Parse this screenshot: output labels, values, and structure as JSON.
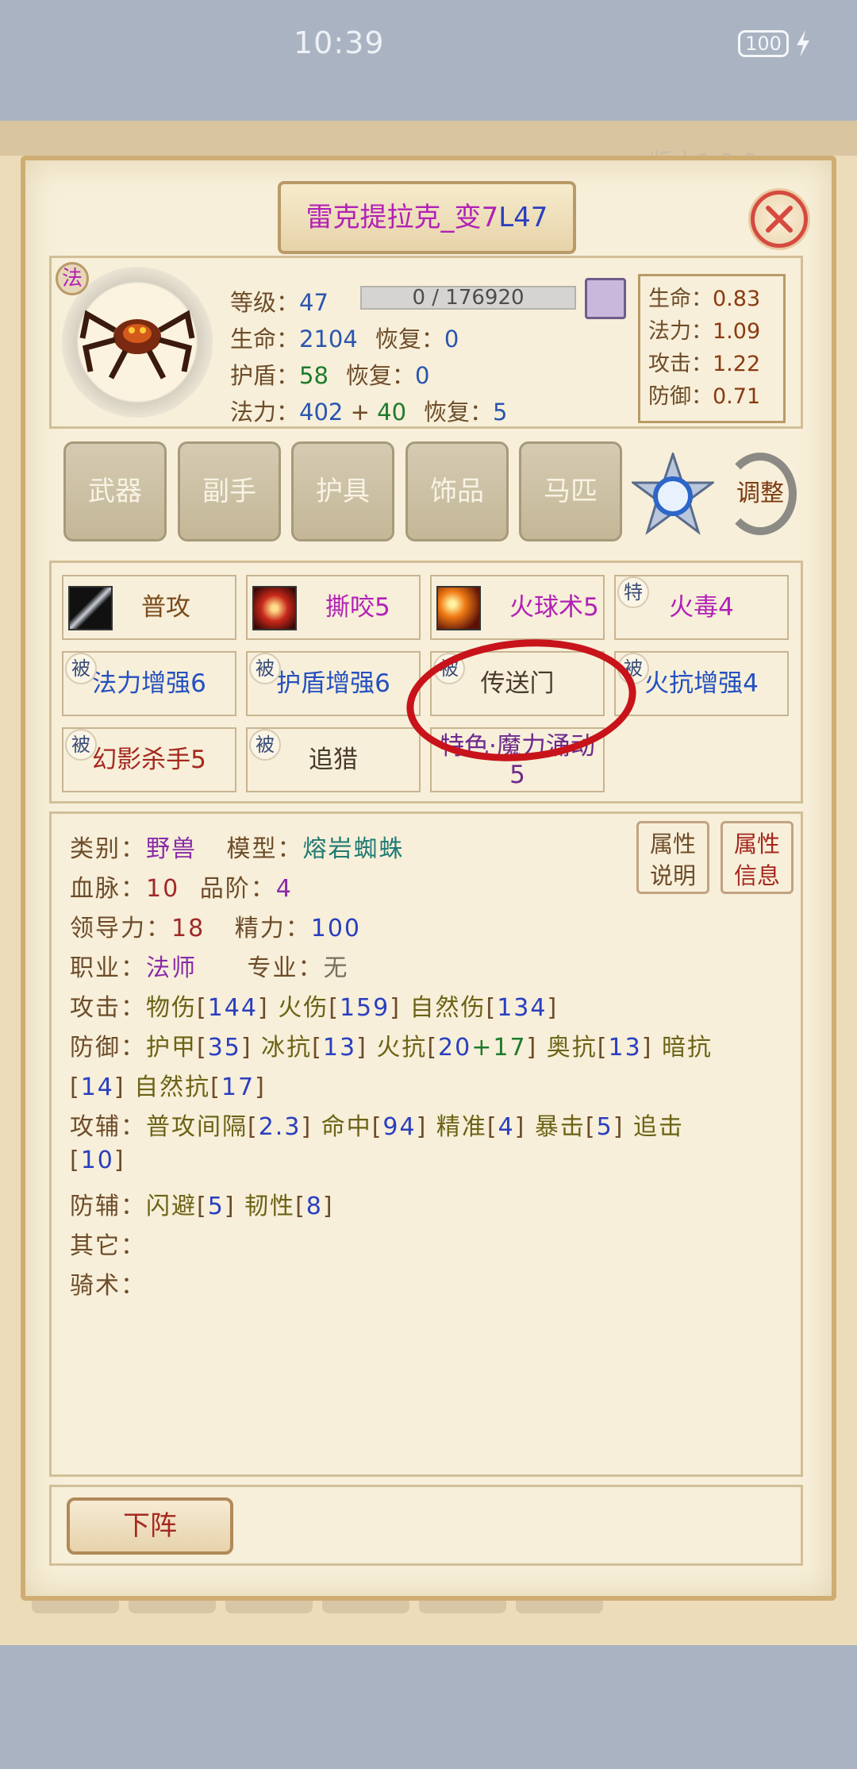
{
  "status_bar": {
    "time": "10:39",
    "battery": "100"
  },
  "version": "版本1.0.0",
  "title": {
    "name": "雷克提拉克_变",
    "num": "7",
    "level": "L47"
  },
  "pet": {
    "class_badge": "法",
    "level_label": "等级：",
    "level": "47",
    "xp": "0 / 176920",
    "hp_label": "生命：",
    "hp": "2104",
    "hp_regen_label": "恢复：",
    "hp_regen": "0",
    "shield_label": "护盾：",
    "shield": "58",
    "shield_regen_label": "恢复：",
    "shield_regen": "0",
    "mana_label": "法力：",
    "mana": "402",
    "mana_plus": "+",
    "mana_bonus": "40",
    "mana_regen_label": "恢复：",
    "mana_regen": "5"
  },
  "growth": [
    {
      "label": "生命：",
      "value": "0.83"
    },
    {
      "label": "法力：",
      "value": "1.09"
    },
    {
      "label": "攻击：",
      "value": "1.22"
    },
    {
      "label": "防御：",
      "value": "0.71"
    }
  ],
  "equipment": [
    "武器",
    "副手",
    "护具",
    "饰品",
    "马匹"
  ],
  "adjust_label": "调整",
  "skills": [
    {
      "label": "普攻",
      "tag": ""
    },
    {
      "label": "撕咬5",
      "tag": ""
    },
    {
      "label": "火球术5",
      "tag": ""
    },
    {
      "label": "火毒4",
      "tag": "特"
    },
    {
      "label": "法力增强6",
      "tag": "被"
    },
    {
      "label": "护盾增强6",
      "tag": "被"
    },
    {
      "label": "传送门",
      "tag": "被"
    },
    {
      "label": "火抗增强4",
      "tag": "被"
    },
    {
      "label": "幻影杀手5",
      "tag": "被"
    },
    {
      "label": "追猎",
      "tag": "被"
    },
    {
      "label": "特色·魔力涌动",
      "label2": "5",
      "tag": ""
    }
  ],
  "details": {
    "type_label": "类别：",
    "type": "野兽",
    "model_label": "模型：",
    "model": "熔岩蜘蛛",
    "blood_label": "血脉：",
    "blood": "10",
    "grade_label": "品阶：",
    "grade": "4",
    "lead_label": "领导力：",
    "lead": "18",
    "energy_label": "精力：",
    "energy": "100",
    "job_label": "职业：",
    "job": "法师",
    "spec_label": "专业：",
    "spec": "无",
    "atk_label": "攻击：",
    "atk": [
      {
        "name": "物伤",
        "val": "144"
      },
      {
        "name": "火伤",
        "val": "159"
      },
      {
        "name": "自然伤",
        "val": "134"
      }
    ],
    "def_label": "防御：",
    "def_line1": [
      {
        "name": "护甲",
        "val": "35"
      },
      {
        "name": "冰抗",
        "val": "13"
      },
      {
        "name": "奥抗",
        "val": "13"
      }
    ],
    "fire_res_name": "火抗",
    "fire_res": "20",
    "fire_res_plus": "+",
    "fire_res_bonus": "17",
    "dark_res_name": "暗抗",
    "dark_res": "14",
    "nature_res_name": "自然抗",
    "nature_res": "17",
    "atkaux_label": "攻辅：",
    "atkaux": [
      {
        "name": "普攻间隔",
        "val": "2.3"
      },
      {
        "name": "命中",
        "val": "94"
      },
      {
        "name": "精准",
        "val": "4"
      },
      {
        "name": "暴击",
        "val": "5"
      }
    ],
    "chase_name": "追击",
    "chase": "10",
    "defaux_label": "防辅：",
    "defaux": [
      {
        "name": "闪避",
        "val": "5"
      },
      {
        "name": "韧性",
        "val": "8"
      }
    ],
    "other_label": "其它：",
    "ride_label": "骑术："
  },
  "prop_buttons": [
    {
      "line1": "属性",
      "line2": "说明"
    },
    {
      "line1": "属性",
      "line2": "信息"
    }
  ],
  "offteam_label": "下阵",
  "colors": {
    "annotation": "#c8131b",
    "panel": "#f7efd9",
    "border": "#cfad72"
  }
}
